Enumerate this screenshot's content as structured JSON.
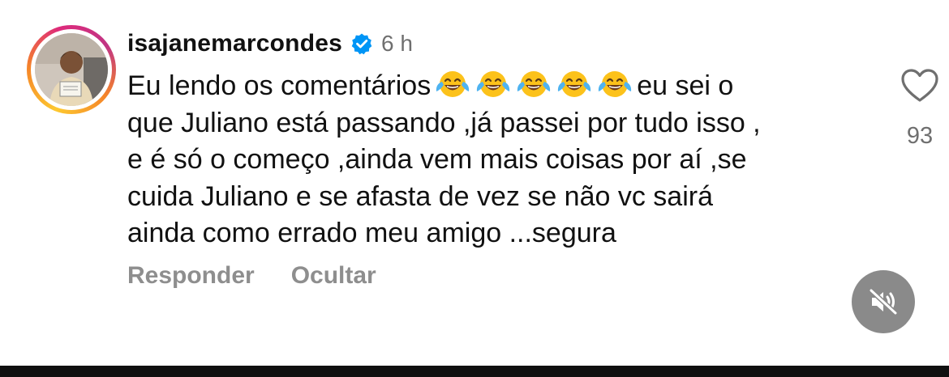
{
  "comment": {
    "username": "isajanemarcondes",
    "verified": true,
    "time": "6 h",
    "lines": [
      "Eu lendo os comentários",
      "eu sei o",
      "que Juliano está passando ,já passei por tudo isso ,",
      "e é só o começo ,ainda vem mais coisas por aí ,se",
      "cuida Juliano e se afasta de vez se não vc sairá",
      "ainda como errado meu amigo ...segura"
    ],
    "emoji_name": "face-with-tears-of-joy",
    "emoji_count": 5,
    "like_count": "93"
  },
  "actions": {
    "reply_label": "Responder",
    "hide_label": "Ocultar"
  },
  "icons": {
    "like": "heart-icon",
    "mute": "speaker-muted-icon",
    "verified": "verified-badge-icon"
  },
  "colors": {
    "verified_blue": "#0095f6",
    "muted_text": "#8e8e8e",
    "text": "#111111"
  }
}
